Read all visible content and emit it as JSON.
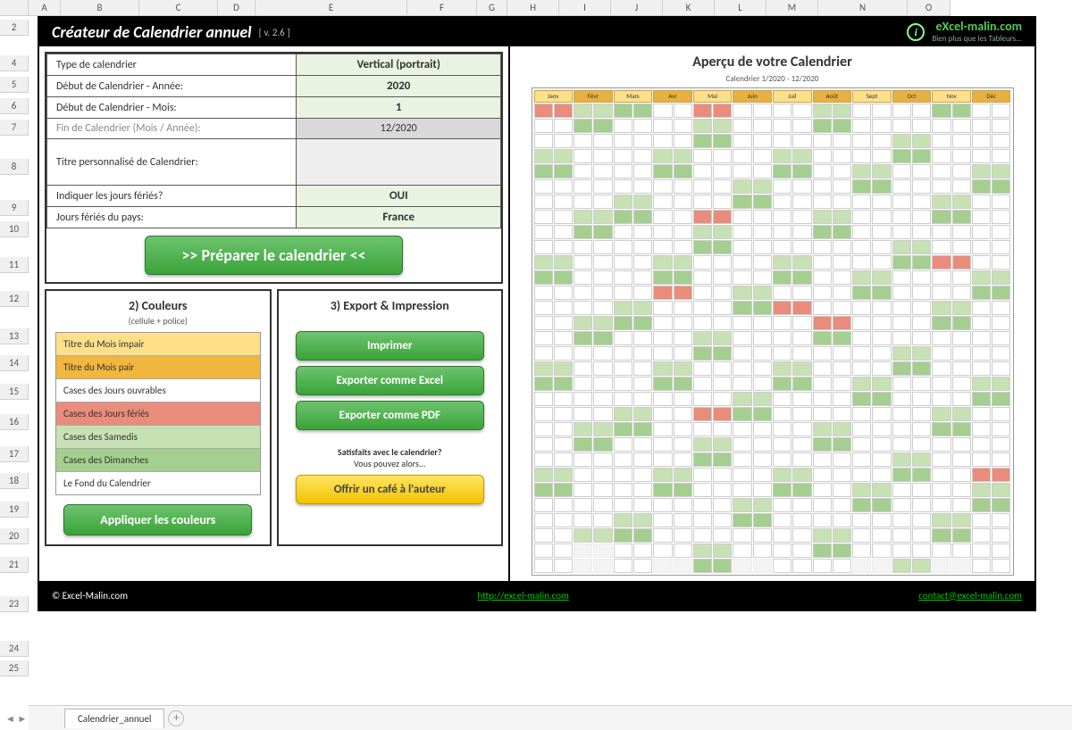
{
  "columns": [
    "A",
    "B",
    "C",
    "D",
    "E",
    "F",
    "G",
    "H",
    "I",
    "J",
    "K",
    "L",
    "M",
    "N",
    "O"
  ],
  "rows": [
    "2",
    "4",
    "5",
    "6",
    "7",
    "8",
    "9",
    "10",
    "11",
    "12",
    "13",
    "14",
    "15",
    "16",
    "17",
    "18",
    "19",
    "20",
    "21",
    "23",
    "24",
    "25"
  ],
  "header": {
    "title": "Créateur de Calendrier annuel",
    "version": "[ v. 2.6 ]",
    "brand": "eXcel-malin.com",
    "brand_sub": "Bien plus que les Tableurs...",
    "brand_icon_letter": "i"
  },
  "config": {
    "type_label": "Type de calendrier",
    "type_value": "Vertical (portrait)",
    "start_year_label": "Début de Calendrier - Année:",
    "start_year_value": "2020",
    "start_month_label": "Début de Calendrier - Mois:",
    "start_month_value": "1",
    "end_label": "Fin de Calendrier (Mois / Année):",
    "end_value": "12/2020",
    "title_label": "Titre personnalisé de Calendrier:",
    "title_value": "",
    "holidays_label": "Indiquer les jours fériés?",
    "holidays_value": "OUI",
    "country_label": "Jours fériés du pays:",
    "country_value": "France"
  },
  "buttons": {
    "prepare": ">>  Préparer le calendrier  <<",
    "apply_colors": "Appliquer les couleurs",
    "print": "Imprimer",
    "export_excel": "Exporter comme Excel",
    "export_pdf": "Exporter comme PDF",
    "coffee": "Offrir un café à l'auteur"
  },
  "colors_section": {
    "title": "2) Couleurs",
    "subtitle": "(cellule + police)",
    "items": [
      {
        "label": "Titre du Mois impair",
        "bg": "#ffe08a"
      },
      {
        "label": "Titre du Mois pair",
        "bg": "#f1b63d"
      },
      {
        "label": "Cases des Jours ouvrables",
        "bg": "#ffffff"
      },
      {
        "label": "Cases des Jours fériés",
        "bg": "#e98c7b"
      },
      {
        "label": "Cases des Samedis",
        "bg": "#c7e1b4"
      },
      {
        "label": "Cases des Dimanches",
        "bg": "#a5cf90"
      },
      {
        "label": "Le Fond du Calendrier",
        "bg": "#ffffff"
      }
    ]
  },
  "export_section": {
    "title": "3) Export & Impression",
    "fine1": "Satisfaits avec le calendrier?",
    "fine2": "Vous pouvez alors..."
  },
  "preview": {
    "title": "Aperçu de votre Calendrier",
    "subtitle": "Calendrier 1/2020 - 12/2020",
    "months": [
      "Janv",
      "Févr",
      "Mars",
      "Avr",
      "Mai",
      "Juin",
      "Juil",
      "Août",
      "Sept",
      "Oct",
      "Nov",
      "Déc"
    ]
  },
  "chart_data": {
    "type": "table",
    "description": "Monthly calendar grid 12 months × 31 days. g=weekend(Samedi), d=weekend(Dimanche), r=holiday, w=workday, e=empty/no-day",
    "months": [
      "Janv",
      "Févr",
      "Mars",
      "Avr",
      "Mai",
      "Juin",
      "Juil",
      "Août",
      "Sept",
      "Oct",
      "Nov",
      "Déc"
    ],
    "days": [
      [
        "r",
        "g",
        "d",
        "w",
        "r",
        "w",
        "w",
        "g",
        "w",
        "w",
        "d",
        "w"
      ],
      [
        "w",
        "d",
        "w",
        "w",
        "g",
        "w",
        "w",
        "d",
        "w",
        "w",
        "w",
        "w"
      ],
      [
        "w",
        "w",
        "w",
        "w",
        "d",
        "w",
        "w",
        "w",
        "w",
        "g",
        "w",
        "w"
      ],
      [
        "g",
        "w",
        "w",
        "g",
        "w",
        "w",
        "g",
        "w",
        "w",
        "d",
        "w",
        "w"
      ],
      [
        "d",
        "w",
        "w",
        "d",
        "w",
        "w",
        "d",
        "w",
        "g",
        "w",
        "w",
        "g"
      ],
      [
        "w",
        "w",
        "w",
        "w",
        "w",
        "g",
        "w",
        "w",
        "d",
        "w",
        "w",
        "d"
      ],
      [
        "w",
        "w",
        "g",
        "w",
        "w",
        "d",
        "w",
        "w",
        "w",
        "w",
        "g",
        "w"
      ],
      [
        "w",
        "g",
        "d",
        "w",
        "r",
        "w",
        "w",
        "g",
        "w",
        "w",
        "d",
        "w"
      ],
      [
        "w",
        "d",
        "w",
        "w",
        "g",
        "w",
        "w",
        "d",
        "w",
        "w",
        "w",
        "w"
      ],
      [
        "w",
        "w",
        "w",
        "w",
        "d",
        "w",
        "w",
        "w",
        "w",
        "g",
        "w",
        "w"
      ],
      [
        "g",
        "w",
        "w",
        "g",
        "w",
        "w",
        "g",
        "w",
        "w",
        "d",
        "r",
        "w"
      ],
      [
        "d",
        "w",
        "w",
        "d",
        "w",
        "w",
        "d",
        "w",
        "g",
        "w",
        "w",
        "g"
      ],
      [
        "w",
        "w",
        "w",
        "r",
        "w",
        "g",
        "w",
        "w",
        "d",
        "w",
        "w",
        "d"
      ],
      [
        "w",
        "w",
        "g",
        "w",
        "w",
        "d",
        "r",
        "w",
        "w",
        "w",
        "g",
        "w"
      ],
      [
        "w",
        "g",
        "d",
        "w",
        "w",
        "w",
        "w",
        "r",
        "w",
        "w",
        "d",
        "w"
      ],
      [
        "w",
        "d",
        "w",
        "w",
        "g",
        "w",
        "w",
        "d",
        "w",
        "w",
        "w",
        "w"
      ],
      [
        "w",
        "w",
        "w",
        "w",
        "d",
        "w",
        "w",
        "w",
        "w",
        "g",
        "w",
        "w"
      ],
      [
        "g",
        "w",
        "w",
        "g",
        "w",
        "w",
        "g",
        "w",
        "w",
        "d",
        "w",
        "w"
      ],
      [
        "d",
        "w",
        "w",
        "d",
        "w",
        "w",
        "d",
        "w",
        "g",
        "w",
        "w",
        "g"
      ],
      [
        "w",
        "w",
        "w",
        "w",
        "w",
        "g",
        "w",
        "w",
        "d",
        "w",
        "w",
        "d"
      ],
      [
        "w",
        "w",
        "g",
        "w",
        "r",
        "d",
        "w",
        "w",
        "w",
        "w",
        "g",
        "w"
      ],
      [
        "w",
        "g",
        "d",
        "w",
        "w",
        "w",
        "w",
        "g",
        "w",
        "w",
        "d",
        "w"
      ],
      [
        "w",
        "d",
        "w",
        "w",
        "g",
        "w",
        "w",
        "d",
        "w",
        "w",
        "w",
        "w"
      ],
      [
        "w",
        "w",
        "w",
        "w",
        "d",
        "w",
        "w",
        "w",
        "w",
        "g",
        "w",
        "w"
      ],
      [
        "g",
        "w",
        "w",
        "g",
        "w",
        "w",
        "g",
        "w",
        "w",
        "d",
        "w",
        "r"
      ],
      [
        "d",
        "w",
        "w",
        "d",
        "w",
        "w",
        "d",
        "w",
        "g",
        "w",
        "w",
        "g"
      ],
      [
        "w",
        "w",
        "w",
        "w",
        "w",
        "g",
        "w",
        "w",
        "d",
        "w",
        "w",
        "d"
      ],
      [
        "w",
        "w",
        "g",
        "w",
        "w",
        "d",
        "w",
        "w",
        "w",
        "w",
        "g",
        "w"
      ],
      [
        "w",
        "g",
        "d",
        "w",
        "w",
        "w",
        "w",
        "g",
        "w",
        "w",
        "d",
        "w"
      ],
      [
        "w",
        "e",
        "w",
        "w",
        "g",
        "w",
        "w",
        "d",
        "w",
        "w",
        "w",
        "w"
      ],
      [
        "w",
        "e",
        "w",
        "e",
        "d",
        "e",
        "w",
        "w",
        "e",
        "g",
        "e",
        "w"
      ]
    ]
  },
  "footer": {
    "copyright": "© Excel-Malin.com",
    "url": "http://excel-malin.com",
    "contact": "contact@excel-malin.com"
  },
  "tabs": {
    "sheet": "Calendrier_annuel"
  }
}
